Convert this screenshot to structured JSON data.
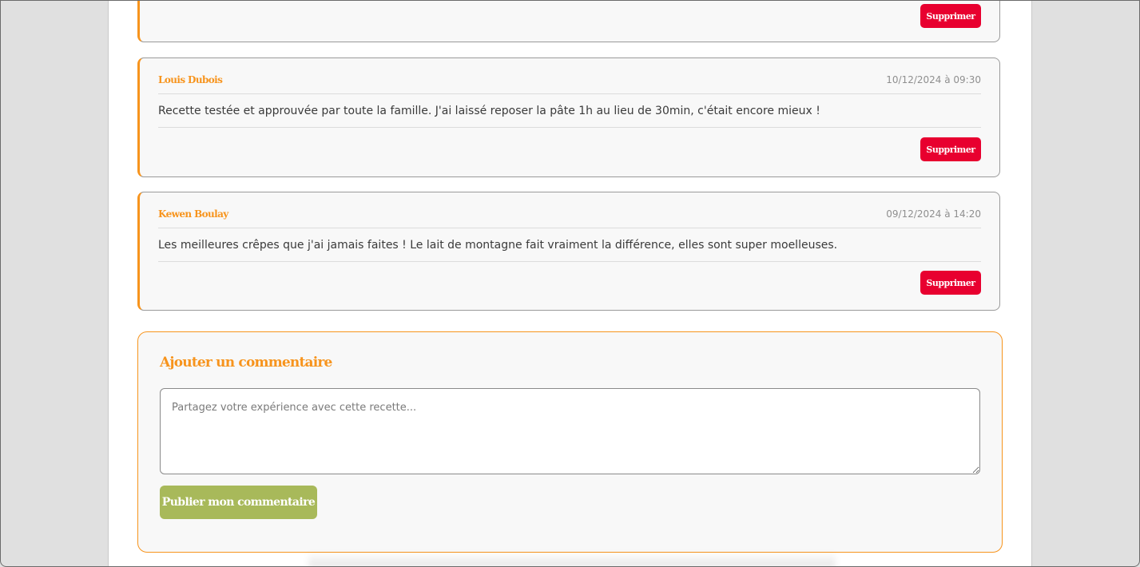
{
  "comments": [
    {
      "author": "",
      "date": "",
      "text": "",
      "delete_label": "Supprimer"
    },
    {
      "author": "Louis Dubois",
      "date": "10/12/2024 à 09:30",
      "text": "Recette testée et approuvée par toute la famille. J'ai laissé reposer la pâte 1h au lieu de 30min, c'était encore mieux !",
      "delete_label": "Supprimer"
    },
    {
      "author": "Kewen Boulay",
      "date": "09/12/2024 à 14:20",
      "text": "Les meilleures crêpes que j'ai jamais faites ! Le lait de montagne fait vraiment la différence, elles sont super moelleuses.",
      "delete_label": "Supprimer"
    }
  ],
  "comment_form": {
    "title": "Ajouter un commentaire",
    "textarea_value": "",
    "textarea_placeholder": "Partagez votre expérience avec cette recette...",
    "submit_label": "Publier mon commentaire"
  },
  "colors": {
    "accent": "#f7941d",
    "delete": "#e8002f",
    "publish": "#a8b95a"
  }
}
